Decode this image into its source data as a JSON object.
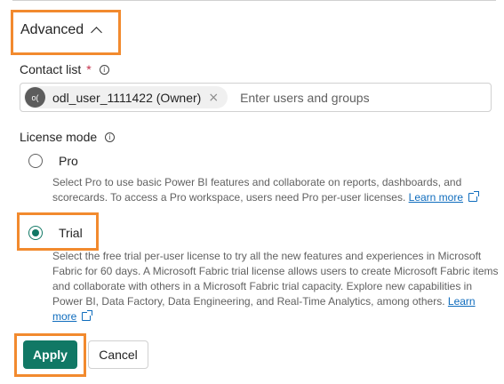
{
  "advanced": {
    "label": "Advanced",
    "expanded": true
  },
  "contact_list": {
    "label": "Contact list",
    "required_marker": "*",
    "info_icon": "info-icon",
    "chips": [
      {
        "avatar_initials": "o(",
        "name": "odl_user_1111422 (Owner)",
        "remove_glyph": "×"
      }
    ],
    "input_placeholder": "Enter users and groups"
  },
  "license_mode": {
    "label": "License mode",
    "info_icon": "info-icon",
    "options": [
      {
        "label": "Pro",
        "selected": false,
        "description": "Select Pro to use basic Power BI features and collaborate on reports, dashboards, and scorecards. To access a Pro workspace, users need Pro per-user licenses.",
        "learn_more": "Learn more"
      },
      {
        "label": "Trial",
        "selected": true,
        "description": "Select the free trial per-user license to try all the new features and experiences in Microsoft Fabric for 60 days. A Microsoft Fabric trial license allows users to create Microsoft Fabric items and collaborate with others in a Microsoft Fabric trial capacity. Explore new capabilities in Power BI, Data Factory, Data Engineering, and Real-Time Analytics, among others.",
        "learn_more": "Learn more"
      }
    ]
  },
  "actions": {
    "apply_label": "Apply",
    "cancel_label": "Cancel"
  },
  "colors": {
    "accent": "#117865",
    "link": "#0f6cbd",
    "required": "#c4314b",
    "highlight": "#f28a2e"
  }
}
